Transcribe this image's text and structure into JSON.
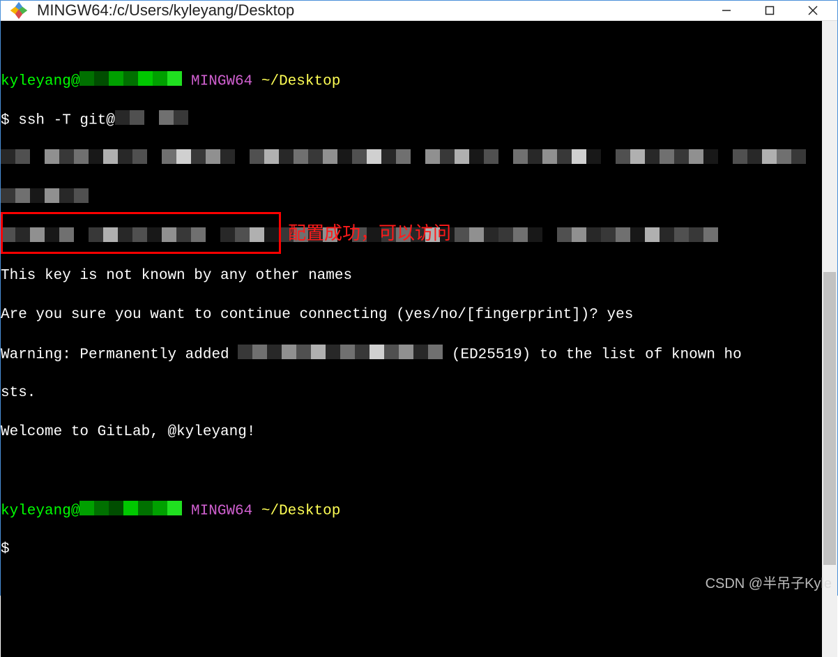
{
  "window": {
    "title": "MINGW64:/c/Users/kyleyang/Desktop"
  },
  "terminal": {
    "prompt1": {
      "user": "kyleyang",
      "env": "MINGW64",
      "cwd": "~/Desktop"
    },
    "cmd1": {
      "symbol": "$",
      "text": "ssh -T git@"
    },
    "msg_key_unknown": "This key is not known by any other names",
    "msg_confirm": "Are you sure you want to continue connecting (yes/no/[fingerprint])? yes",
    "msg_warning_a": "Warning: Permanently added ",
    "msg_warning_b": " (ED25519) to the list of known ho",
    "msg_warning_c": "sts.",
    "msg_welcome": "Welcome to GitLab, @kyleyang!",
    "prompt2": {
      "user": "kyleyang",
      "env": "MINGW64",
      "cwd": "~/Desktop"
    },
    "cmd2": {
      "symbol": "$"
    }
  },
  "annotation": "配置成功，可以访问",
  "watermark": "CSDN @半吊子Kyle"
}
